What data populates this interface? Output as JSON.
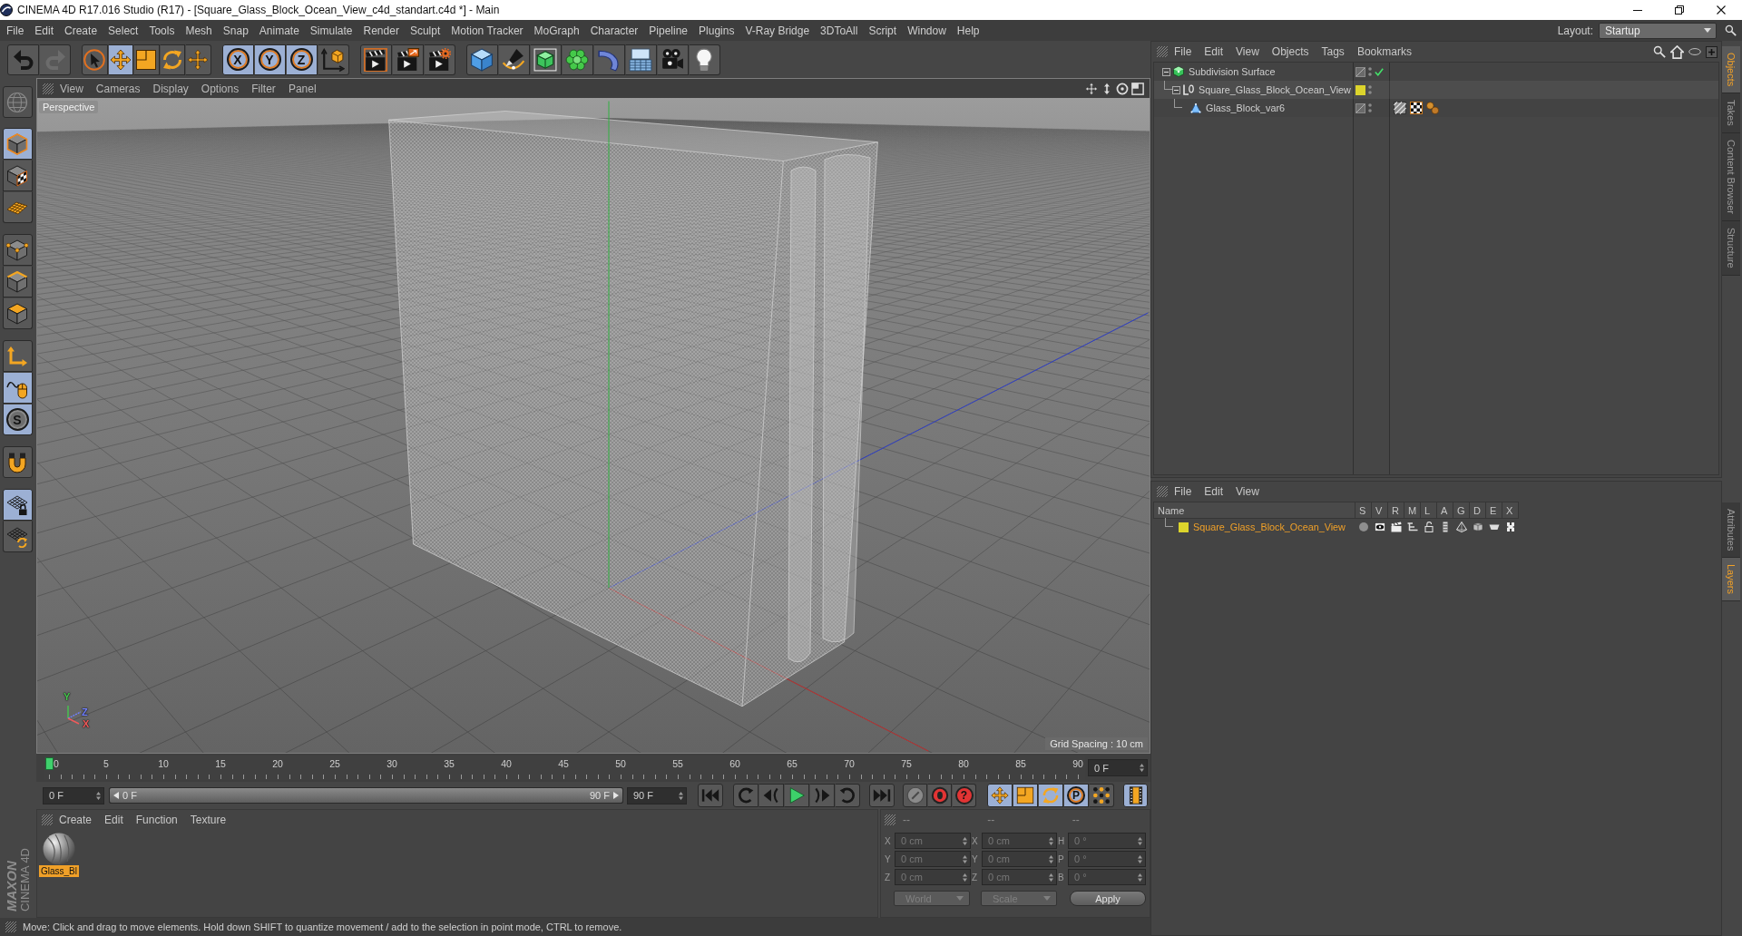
{
  "window": {
    "title": "CINEMA 4D R17.016 Studio (R17) - [Square_Glass_Block_Ocean_View_c4d_standart.c4d *] - Main"
  },
  "menu_bar": {
    "items": [
      "File",
      "Edit",
      "Create",
      "Select",
      "Tools",
      "Mesh",
      "Snap",
      "Animate",
      "Simulate",
      "Render",
      "Sculpt",
      "Motion Tracker",
      "MoGraph",
      "Character",
      "Pipeline",
      "Plugins",
      "V-Ray Bridge",
      "3DToAll",
      "Script",
      "Window",
      "Help"
    ],
    "layout_label": "Layout:",
    "layout": "Startup"
  },
  "toolbar": {
    "history": [
      {
        "disabled": false
      },
      {
        "disabled": true
      }
    ],
    "tools": [
      {
        "selected": false
      },
      {
        "selected": true
      },
      {
        "selected": false
      },
      {
        "selected": false
      },
      {
        "selected": false
      }
    ],
    "axes": [
      {
        "label": "X",
        "selected": true
      },
      {
        "label": "Y",
        "selected": true
      },
      {
        "label": "Z",
        "selected": true
      },
      {
        "selected": false
      }
    ]
  },
  "left_toolbar": {
    "command": {
      "disabled": true
    },
    "groups": [
      [
        {
          "selected": true
        },
        {
          "selected": false
        },
        {
          "selected": false
        }
      ],
      [
        {
          "selected": false
        },
        {
          "selected": false
        },
        {
          "selected": false
        }
      ],
      [
        {
          "selected": false
        },
        {
          "selected": true
        },
        {
          "label": "S",
          "selected": true
        }
      ],
      [
        {
          "selected": false
        }
      ],
      [
        {
          "selected": true
        },
        {
          "selected": false
        }
      ]
    ]
  },
  "logo": {
    "brand": "MAXON",
    "product": "CINEMA 4D"
  },
  "viewport": {
    "menu": [
      "View",
      "Cameras",
      "Display",
      "Options",
      "Filter",
      "Panel"
    ],
    "camera": "Perspective",
    "grid_spacing": "Grid Spacing : 10 cm",
    "gizmo_axes": [
      {
        "label": "Y",
        "color": "#46c84e"
      },
      {
        "label": "Z",
        "color": "#7080ff"
      },
      {
        "label": "X",
        "color": "#f05a5a"
      }
    ]
  },
  "timeline": {
    "ticks": [
      "0",
      "5",
      "10",
      "15",
      "20",
      "25",
      "30",
      "35",
      "40",
      "45",
      "50",
      "55",
      "60",
      "65",
      "70",
      "75",
      "80",
      "85",
      "90"
    ],
    "level": 0,
    "frame": "0 F"
  },
  "transport": {
    "start": "0 F",
    "range": {
      "start": "0 F",
      "end": "90 F",
      "level": 1
    },
    "end": "90 F",
    "record": [
      {
        "disabled": true
      },
      {
        "disabled": false
      },
      {
        "label": "?",
        "disabled": false
      }
    ],
    "modes": [
      {
        "selected": true
      },
      {
        "selected": true
      },
      {
        "selected": true
      },
      {
        "label": "P",
        "selected": true
      },
      {
        "selected": false
      }
    ],
    "timeline_toggle": {
      "selected": true
    }
  },
  "material_manager": {
    "menu": [
      "Create",
      "Edit",
      "Function",
      "Texture"
    ],
    "materials": [
      {
        "name": "Glass_Bl",
        "selected": true
      }
    ]
  },
  "coordinates": {
    "headers": [
      "--",
      "--",
      "--"
    ],
    "disabled": true,
    "rows": [
      {
        "position_axis": "X",
        "position": "0 cm",
        "size_axis": "X",
        "size": "0 cm",
        "rotation_axis": "H",
        "rotation": "0 °"
      },
      {
        "position_axis": "Y",
        "position": "0 cm",
        "size_axis": "Y",
        "size": "0 cm",
        "rotation_axis": "P",
        "rotation": "0 °"
      },
      {
        "position_axis": "Z",
        "position": "0 cm",
        "size_axis": "Z",
        "size": "0 cm",
        "rotation_axis": "B",
        "rotation": "0 °"
      }
    ],
    "mode": "World",
    "size_mode": "Scale",
    "apply": "Apply"
  },
  "status_bar": {
    "text": "Move: Click and drag to move elements. Hold down SHIFT to quantize movement / add to the selection in point mode, CTRL to remove."
  },
  "objects_manager": {
    "menu": [
      "File",
      "Edit",
      "View",
      "Objects",
      "Tags",
      "Bookmarks"
    ],
    "objects": [
      {
        "name": "Subdivision Surface",
        "kind": "subdivision",
        "expanded": true,
        "enabled": true,
        "children": [
          {
            "name": "Square_Glass_Block_Ocean_View",
            "kind": "null",
            "expanded": true,
            "color": "#dcd42c",
            "children": [
              {
                "name": "Glass_Block_var6",
                "kind": "polygon",
                "tags": [
                  {
                    "kind": "material"
                  },
                  {
                    "kind": "checker"
                  },
                  {
                    "kind": "spheres"
                  }
                ]
              }
            ]
          }
        ]
      }
    ]
  },
  "layers_manager": {
    "menu": [
      "File",
      "Edit",
      "View"
    ],
    "columns": [
      "Name",
      "S",
      "V",
      "R",
      "M",
      "L",
      "A",
      "G",
      "D",
      "E",
      "X"
    ],
    "layers": [
      {
        "name": "Square_Glass_Block_Ocean_View",
        "color": "#dcd42c",
        "selected": true
      }
    ]
  },
  "side_tabs": {
    "top": [
      {
        "label": "Objects",
        "selected": true
      },
      {
        "label": "Takes",
        "selected": false
      },
      {
        "label": "Content Browser",
        "selected": false
      },
      {
        "label": "Structure",
        "selected": false
      }
    ],
    "bottom": [
      {
        "label": "Attributes",
        "selected": false
      },
      {
        "label": "Layers",
        "selected": true
      }
    ]
  }
}
